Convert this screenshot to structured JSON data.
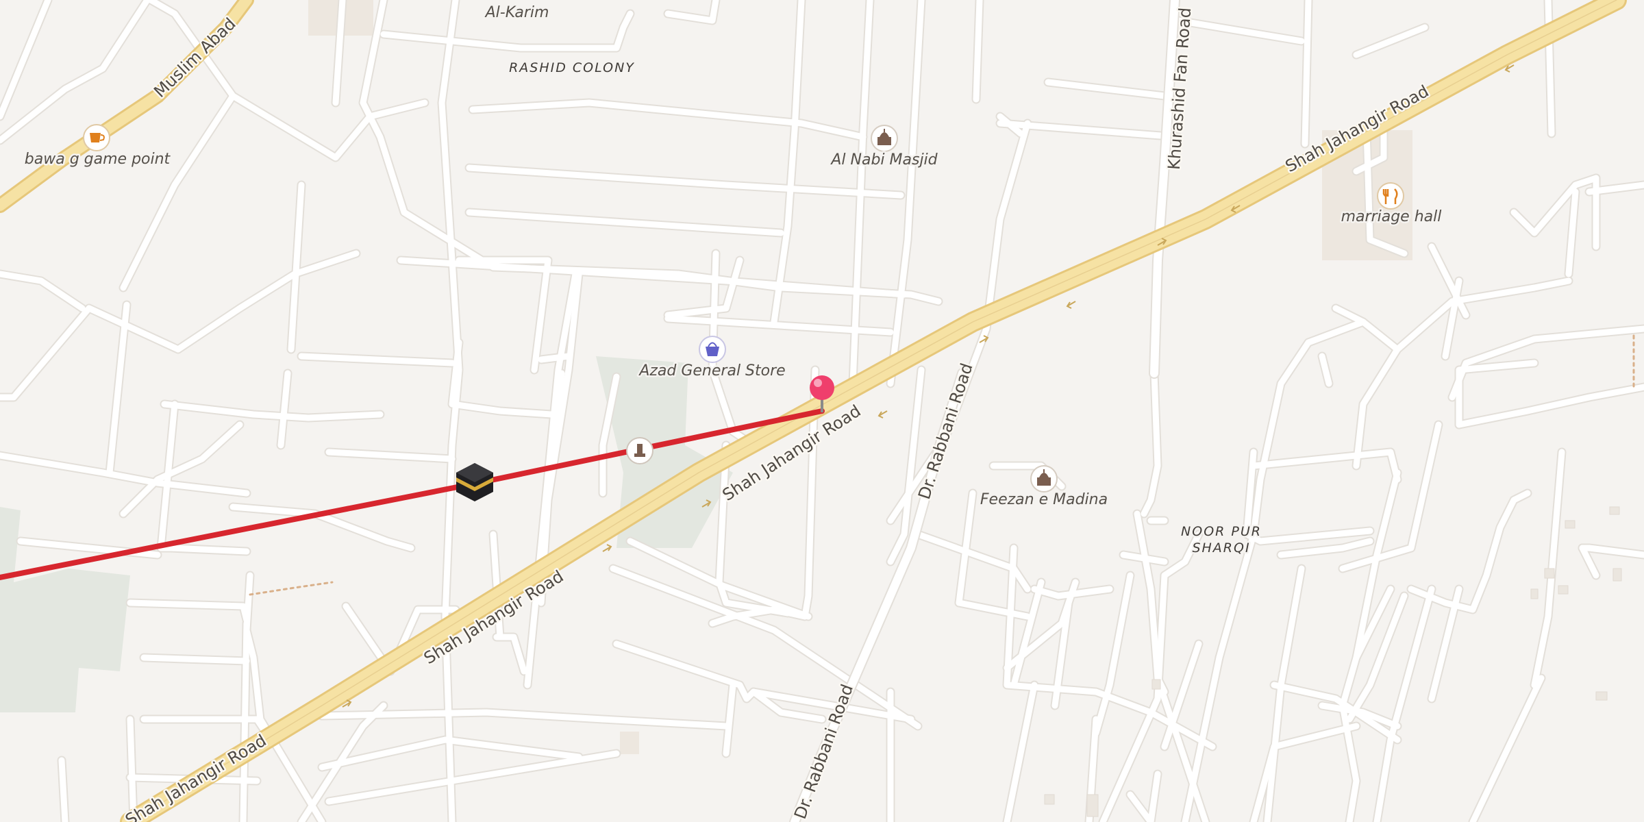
{
  "map": {
    "colors": {
      "background": "#f5f3f0",
      "minor_road": "#ffffff",
      "minor_road_casing": "#e3dfd9",
      "major_road": "#f6e2a4",
      "major_road_casing": "#e6c77a",
      "park": "#e3e7e0",
      "route_line": "#d7262e",
      "pin": "#ef3f6c"
    },
    "places": [
      {
        "name": "Al-Karim",
        "icon": "none"
      },
      {
        "name": "bawa g game point",
        "icon": "cafe-icon"
      },
      {
        "name": "Al Nabi Masjid",
        "icon": "mosque-icon"
      },
      {
        "name": "marriage hall",
        "icon": "restaurant-icon"
      },
      {
        "name": "Azad General Store",
        "icon": "shopping-basket-icon"
      },
      {
        "name": "Feezan e Madina",
        "icon": "mosque-icon"
      }
    ],
    "areas": {
      "rashid_colony": "RASHID COLONY",
      "noor_pur_line1": "NOOR PUR",
      "noor_pur_line2": "SHARQI"
    },
    "roads": {
      "muslim_abad": "Muslim Abad",
      "shah_jahangir_1": "Shah Jahangir Road",
      "shah_jahangir_2": "Shah Jahangir Road",
      "shah_jahangir_3": "Shah Jahangir Road",
      "shah_jahangir_4": "Shah Jahangir Road",
      "khurashid_fan": "Khurashid Fan Road",
      "dr_rabbani_1": "Dr. Rabbani Road",
      "dr_rabbani_2": "Dr. Rabbani Road"
    },
    "markers": {
      "destination": "map-pin-icon",
      "origin": "kaaba-icon",
      "monument": "monument-icon"
    }
  }
}
